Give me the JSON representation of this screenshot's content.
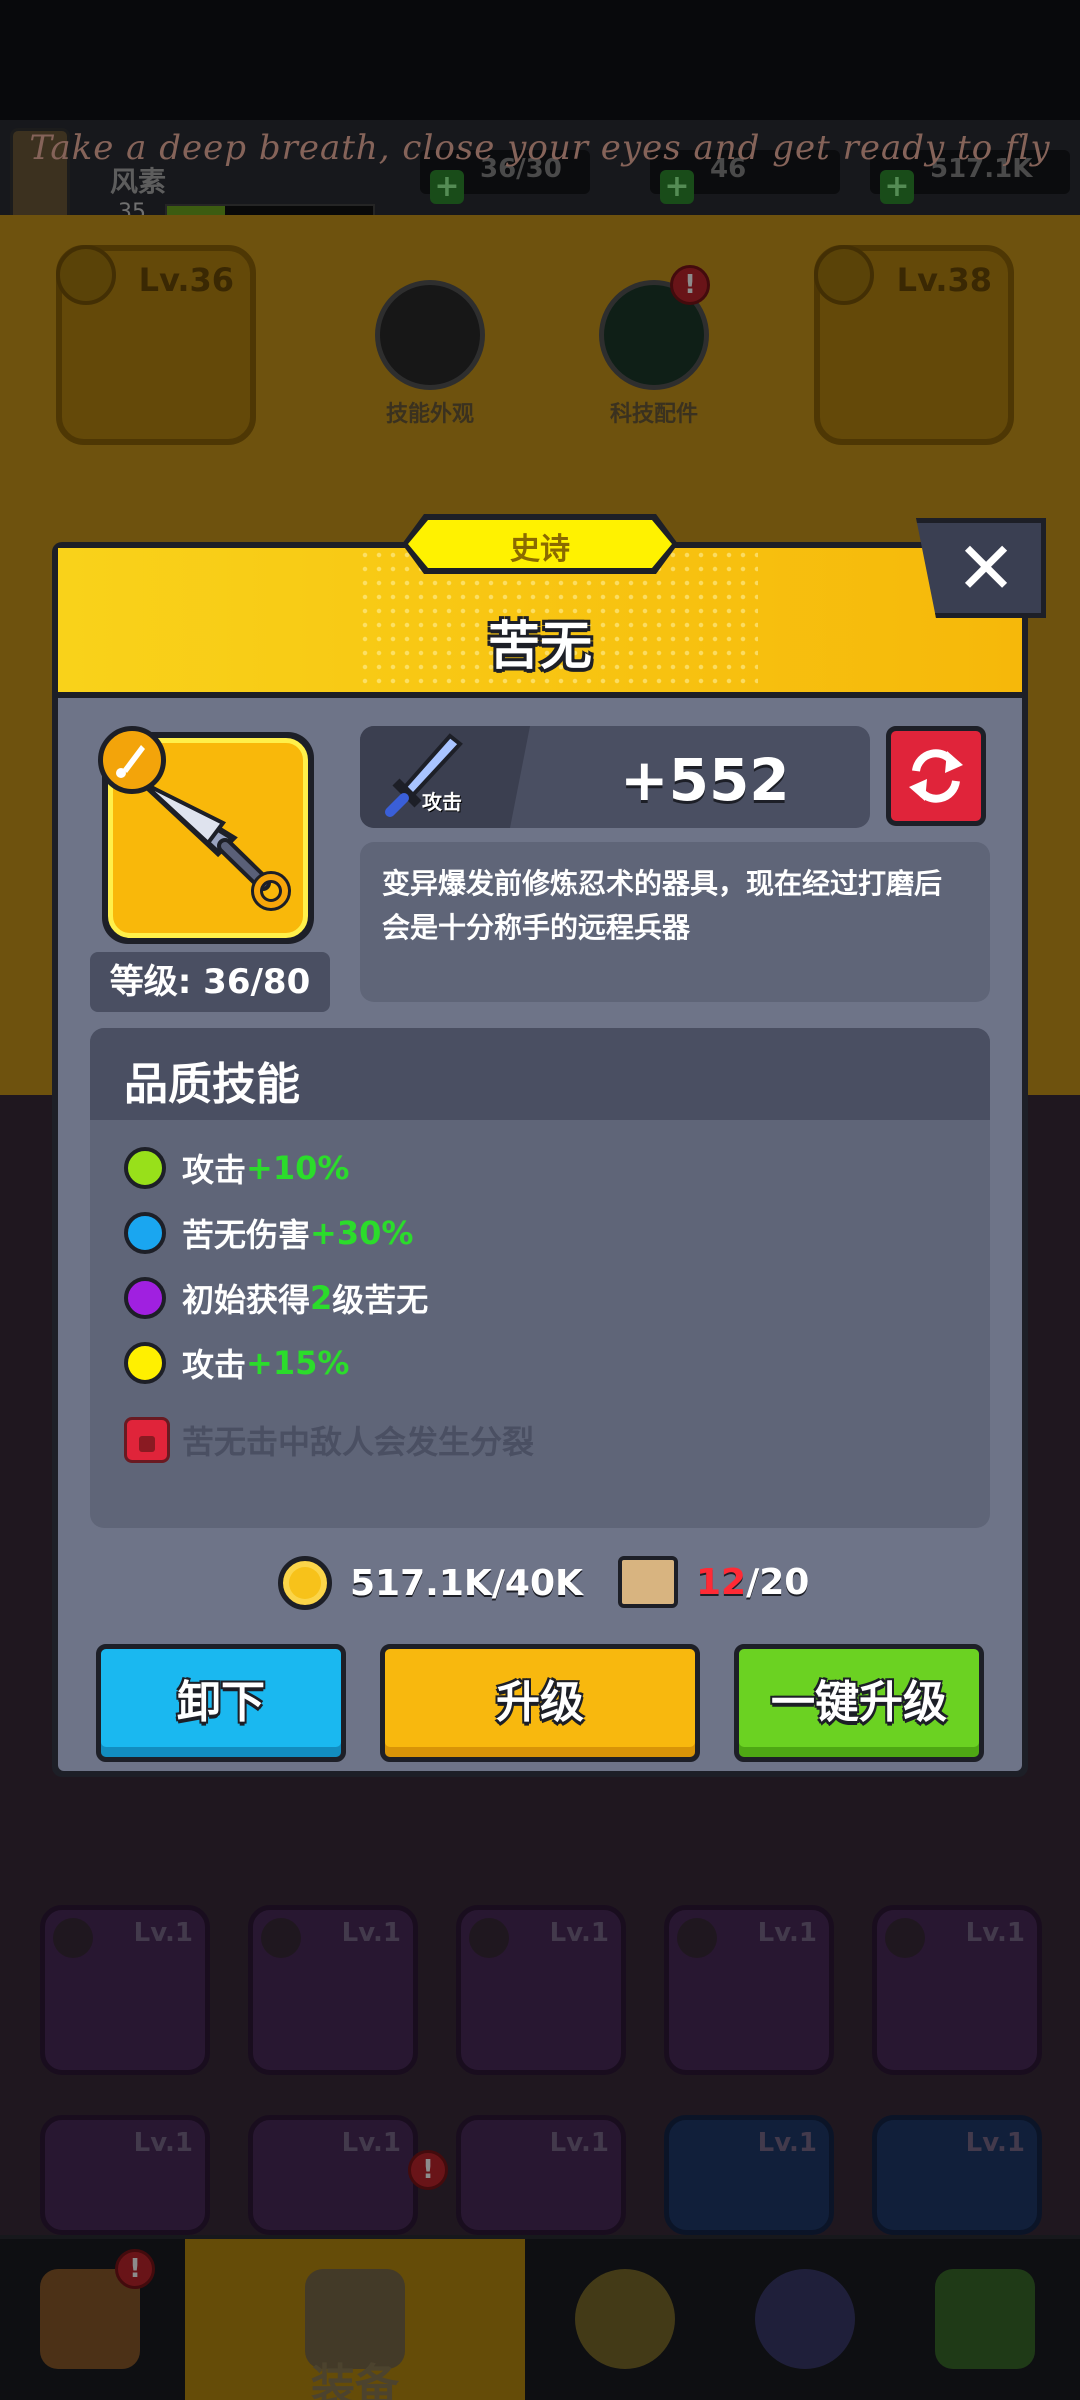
{
  "topbar": {
    "quote": "Take a deep breath, close your eyes and get ready to fly",
    "player_name": "风素",
    "player_level": "35",
    "xp_fraction": 0.28,
    "resources": [
      "36/30",
      "46",
      "517.1K"
    ]
  },
  "background": {
    "left_slot_level": "Lv.36",
    "right_slot_level": "Lv.38",
    "skill_skin_label": "技能外观",
    "tech_parts_label": "科技配件",
    "grid_levels": [
      "Lv.1",
      "Lv.1",
      "Lv.1",
      "Lv.1",
      "Lv.1",
      "Lv.1",
      "Lv.1",
      "Lv.1",
      "Lv.1",
      "Lv.1"
    ]
  },
  "nav": {
    "equipment_label": "装备"
  },
  "modal": {
    "rarity": "史诗",
    "title": "苦无",
    "close_glyph": "✕",
    "level_text": "等级: 36/80",
    "stat": {
      "label": "攻击",
      "value": "+552"
    },
    "description": "变异爆发前修炼忍术的器具，现在经过打磨后会是十分称手的远程兵器",
    "skills_title": "品质技能",
    "skills": [
      {
        "color": "#98e01a",
        "name": "攻击",
        "bonus": "+10%"
      },
      {
        "color": "#1aa6f0",
        "name": "苦无伤害",
        "bonus": "+30%"
      },
      {
        "color": "#a020e0",
        "name": "初始获得",
        "bonus": "2",
        "suffix": "级苦无"
      },
      {
        "color": "#fff000",
        "name": "攻击",
        "bonus": "+15%"
      }
    ],
    "locked_skill": "苦无击中敌人会发生分裂",
    "cost": {
      "gold": "517.1K/40K",
      "scroll_have": "12",
      "scroll_need": "/20"
    },
    "buttons": {
      "unequip": "卸下",
      "upgrade": "升级",
      "max_upgrade": "一键升级"
    }
  }
}
